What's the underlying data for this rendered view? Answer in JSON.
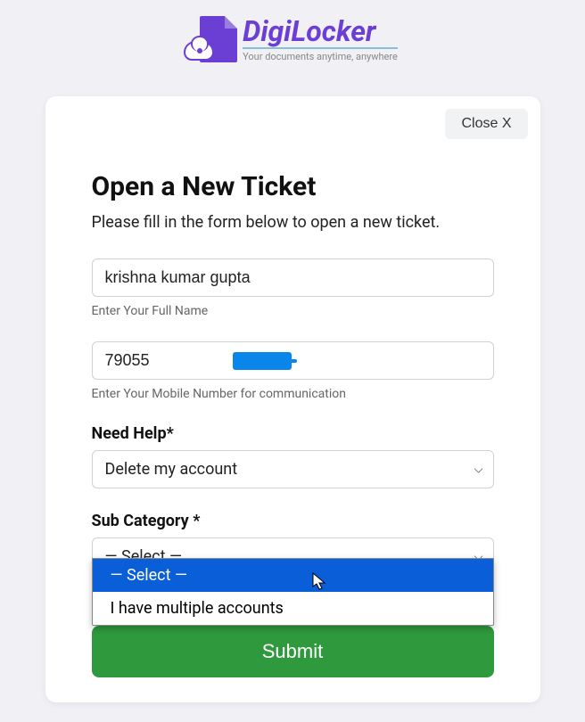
{
  "brand": {
    "name": "DigiLocker",
    "tagline": "Your documents anytime, anywhere"
  },
  "close_label": "Close X",
  "title": "Open a New Ticket",
  "subtitle": "Please fill in the form below to open a new ticket.",
  "name": {
    "value": "krishna kumar gupta",
    "hint": "Enter Your Full Name"
  },
  "mobile": {
    "value": "79055",
    "hint": "Enter Your Mobile Number for communication"
  },
  "help": {
    "label": "Need Help*",
    "selected": "Delete my account"
  },
  "subcat": {
    "label": "Sub Category *",
    "selected": "— Select —",
    "options": [
      "— Select —",
      "I have multiple accounts"
    ]
  },
  "submit_label": "Submit"
}
